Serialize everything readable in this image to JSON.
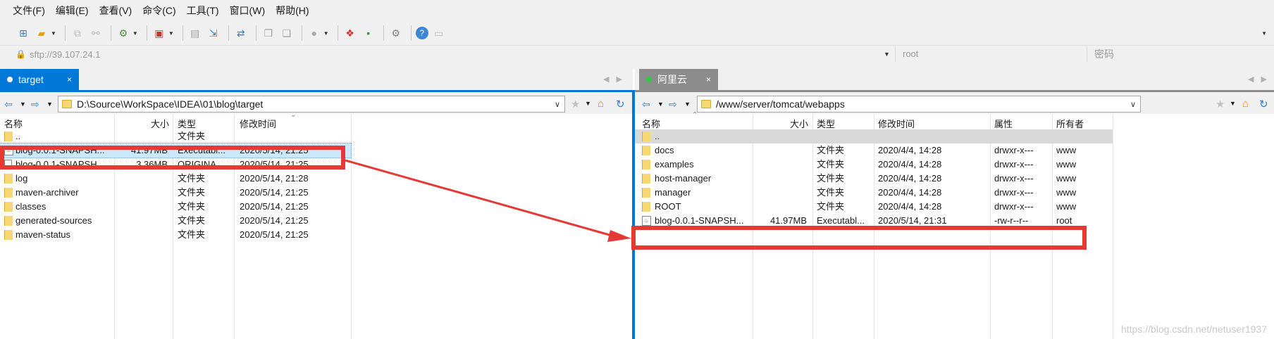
{
  "menu": [
    "文件(F)",
    "编辑(E)",
    "查看(V)",
    "命令(C)",
    "工具(T)",
    "窗口(W)",
    "帮助(H)"
  ],
  "connection": {
    "host": "sftp://39.107.24.1",
    "user_placeholder": "root",
    "password_placeholder": "密码"
  },
  "left": {
    "tab": {
      "label": "target",
      "close": "×",
      "color": "#0078d7"
    },
    "path": "D:\\Source\\WorkSpace\\IDEA\\01\\blog\\target",
    "columns": {
      "name": "名称",
      "size": "大小",
      "type": "类型",
      "modified": "修改时间"
    },
    "rows": [
      {
        "icon": "folder",
        "name": "..",
        "size": "",
        "type": "文件夹",
        "modified": ""
      },
      {
        "icon": "jar",
        "name": "blog-0.0.1-SNAPSH...",
        "size": "41.97MB",
        "type": "Executabl...",
        "modified": "2020/5/14, 21:25",
        "selected": true
      },
      {
        "icon": "file",
        "name": "blog-0.0.1-SNAPSH...",
        "size": "3.36MB",
        "type": "ORIGINA...",
        "modified": "2020/5/14, 21:25"
      },
      {
        "icon": "folder",
        "name": "log",
        "size": "",
        "type": "文件夹",
        "modified": "2020/5/14, 21:28"
      },
      {
        "icon": "folder",
        "name": "maven-archiver",
        "size": "",
        "type": "文件夹",
        "modified": "2020/5/14, 21:25"
      },
      {
        "icon": "folder",
        "name": "classes",
        "size": "",
        "type": "文件夹",
        "modified": "2020/5/14, 21:25"
      },
      {
        "icon": "folder",
        "name": "generated-sources",
        "size": "",
        "type": "文件夹",
        "modified": "2020/5/14, 21:25"
      },
      {
        "icon": "folder",
        "name": "maven-status",
        "size": "",
        "type": "文件夹",
        "modified": "2020/5/14, 21:25"
      }
    ]
  },
  "right": {
    "tab": {
      "label": "阿里云",
      "close": "×",
      "color": "#8c8c8c"
    },
    "path": "/www/server/tomcat/webapps",
    "columns": {
      "name": "名称",
      "size": "大小",
      "type": "类型",
      "modified": "修改时间",
      "attrs": "属性",
      "owner": "所有者"
    },
    "rows": [
      {
        "icon": "folder",
        "name": "..",
        "size": "",
        "type": "",
        "modified": "",
        "attrs": "",
        "owner": "",
        "selected": true
      },
      {
        "icon": "folder",
        "name": "docs",
        "size": "",
        "type": "文件夹",
        "modified": "2020/4/4, 14:28",
        "attrs": "drwxr-x---",
        "owner": "www"
      },
      {
        "icon": "folder",
        "name": "examples",
        "size": "",
        "type": "文件夹",
        "modified": "2020/4/4, 14:28",
        "attrs": "drwxr-x---",
        "owner": "www"
      },
      {
        "icon": "folder",
        "name": "host-manager",
        "size": "",
        "type": "文件夹",
        "modified": "2020/4/4, 14:28",
        "attrs": "drwxr-x---",
        "owner": "www"
      },
      {
        "icon": "folder",
        "name": "manager",
        "size": "",
        "type": "文件夹",
        "modified": "2020/4/4, 14:28",
        "attrs": "drwxr-x---",
        "owner": "www"
      },
      {
        "icon": "folder",
        "name": "ROOT",
        "size": "",
        "type": "文件夹",
        "modified": "2020/4/4, 14:28",
        "attrs": "drwxr-x---",
        "owner": "www"
      },
      {
        "icon": "jar",
        "name": "blog-0.0.1-SNAPSH...",
        "size": "41.97MB",
        "type": "Executabl...",
        "modified": "2020/5/14, 21:31",
        "attrs": "-rw-r--r--",
        "owner": "root"
      }
    ]
  },
  "watermark": "https://blog.csdn.net/netuser1937",
  "colors": {
    "annotation": "#e53935",
    "accent": "#0078d7",
    "selection": "#cce8ff"
  }
}
